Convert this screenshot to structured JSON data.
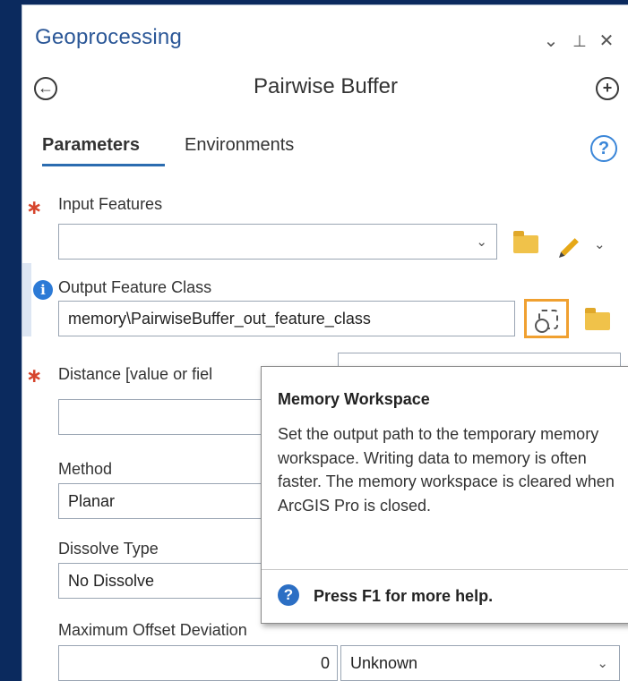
{
  "pane": {
    "title": "Geoprocessing",
    "controls": {
      "dropdown": "⌄",
      "pin": "⊥",
      "close": "✕"
    }
  },
  "tool": {
    "name": "Pairwise Buffer",
    "back_glyph": "←",
    "add_glyph": "+"
  },
  "tabs": [
    {
      "label": "Parameters",
      "active": true
    },
    {
      "label": "Environments",
      "active": false
    }
  ],
  "help_glyph": "?",
  "params": {
    "input_features": {
      "label": "Input Features",
      "value": "",
      "required": true
    },
    "output_feature_class": {
      "label": "Output Feature Class",
      "value": "memory\\PairwiseBuffer_out_feature_class",
      "info": "i"
    },
    "distance": {
      "label": "Distance [value or fiel",
      "value": "",
      "required": true
    },
    "method": {
      "label": "Method",
      "value": "Planar"
    },
    "dissolve_type": {
      "label": "Dissolve Type",
      "value": "No Dissolve"
    },
    "max_offset": {
      "label": "Maximum Offset Deviation",
      "value": "0",
      "unit": "Unknown"
    }
  },
  "tooltip": {
    "title": "Memory Workspace",
    "body": "Set the output path to the temporary memory workspace. Writing data to memory is often faster. The memory workspace is cleared when ArcGIS Pro is closed.",
    "help_text": "Press F1 for more help.",
    "help_glyph": "?"
  },
  "colors": {
    "background": "#0b2a5e",
    "title": "#2b5797",
    "accent": "#2b6cb0",
    "required": "#d6452d",
    "highlight": "#f0a030",
    "folder": "#f0c24a"
  },
  "icons": [
    "back-arrow-icon",
    "add-icon",
    "help-icon",
    "folder-icon",
    "pencil-icon",
    "info-icon",
    "memory-workspace-icon",
    "chevron-down-icon"
  ]
}
